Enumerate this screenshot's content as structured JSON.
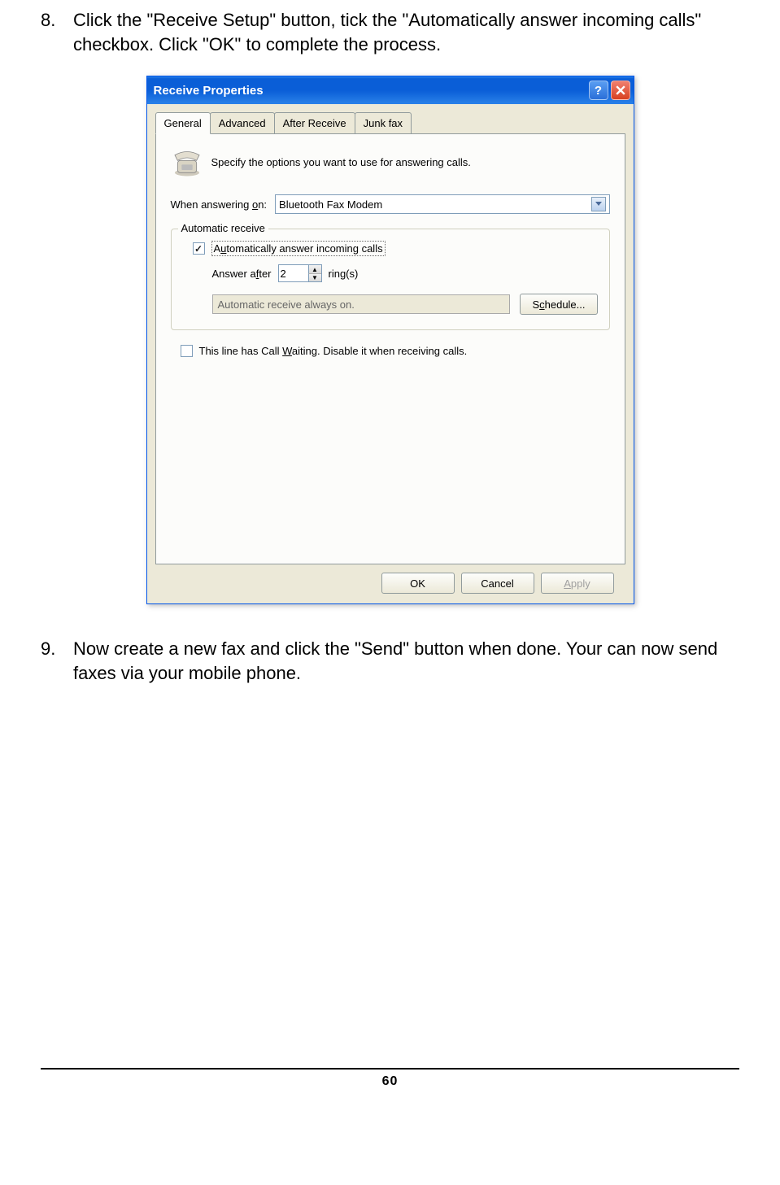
{
  "steps": {
    "s8": {
      "num": "8.",
      "text": "Click the \"Receive Setup\" button, tick the \"Automatically answer incoming calls\" checkbox. Click \"OK\" to complete the process."
    },
    "s9": {
      "num": "9.",
      "text": "Now create a new fax and click the \"Send\" button when done. Your can now send faxes via your mobile phone."
    }
  },
  "dialog": {
    "title": "Receive Properties",
    "tabs": {
      "general": "General",
      "advanced": "Advanced",
      "after": "After Receive",
      "junk": "Junk fax"
    },
    "intro": "Specify the options you want to use for answering calls.",
    "when_label_pre": "When answering ",
    "when_label_u": "o",
    "when_label_post": "n:",
    "modem": "Bluetooth Fax Modem",
    "group_legend": "Automatic receive",
    "auto_pre": "A",
    "auto_u": "u",
    "auto_post": "tomatically answer incoming calls",
    "after_pre": "Answer a",
    "after_u": "f",
    "after_post": "ter",
    "ring_value": "2",
    "ring_suffix": "ring(s)",
    "status_text": "Automatic receive always on.",
    "schedule_pre": "S",
    "schedule_u": "c",
    "schedule_post": "hedule...",
    "callwait_pre": "This line has Call ",
    "callwait_u": "W",
    "callwait_post": "aiting. Disable it when receiving calls.",
    "buttons": {
      "ok": "OK",
      "cancel": "Cancel",
      "apply_pre": "",
      "apply_u": "A",
      "apply_post": "pply"
    }
  },
  "page_number": "60"
}
